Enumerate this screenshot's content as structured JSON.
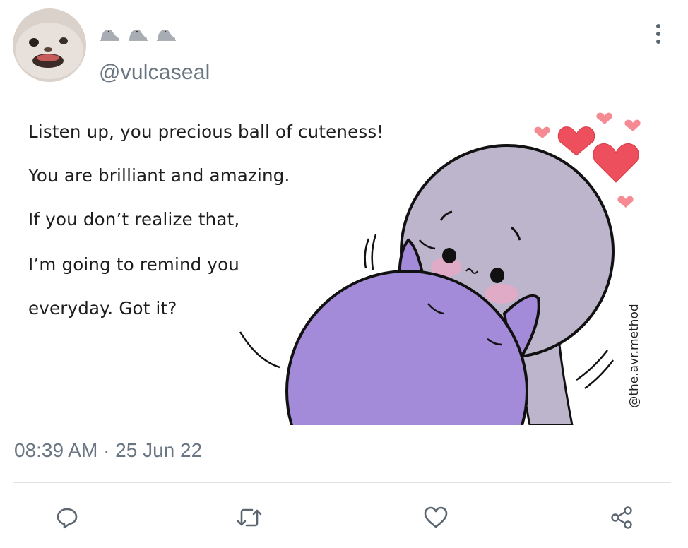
{
  "tweet": {
    "display_name_icons": [
      "seal-icon",
      "seal-icon",
      "seal-icon"
    ],
    "handle": "@vulcaseal",
    "timestamp": "08:39 AM · 25 Jun 22",
    "image": {
      "text_lines": [
        "Listen up, you precious ball of cuteness!",
        "You are brilliant and amazing.",
        "If you don’t realize that,",
        "I’m going to remind you",
        "everyday. Got it?"
      ],
      "credit": "@the.avr.method"
    }
  },
  "actions": [
    "reply-icon",
    "retweet-icon",
    "like-icon",
    "share-icon"
  ],
  "colors": {
    "secondary_text": "#6b7683",
    "icon": "#5b6670",
    "divider": "#dfe3e7",
    "character_gray": "#bcb5cc",
    "character_purple": "#a48bd9",
    "heart": "#ee4f5c"
  }
}
